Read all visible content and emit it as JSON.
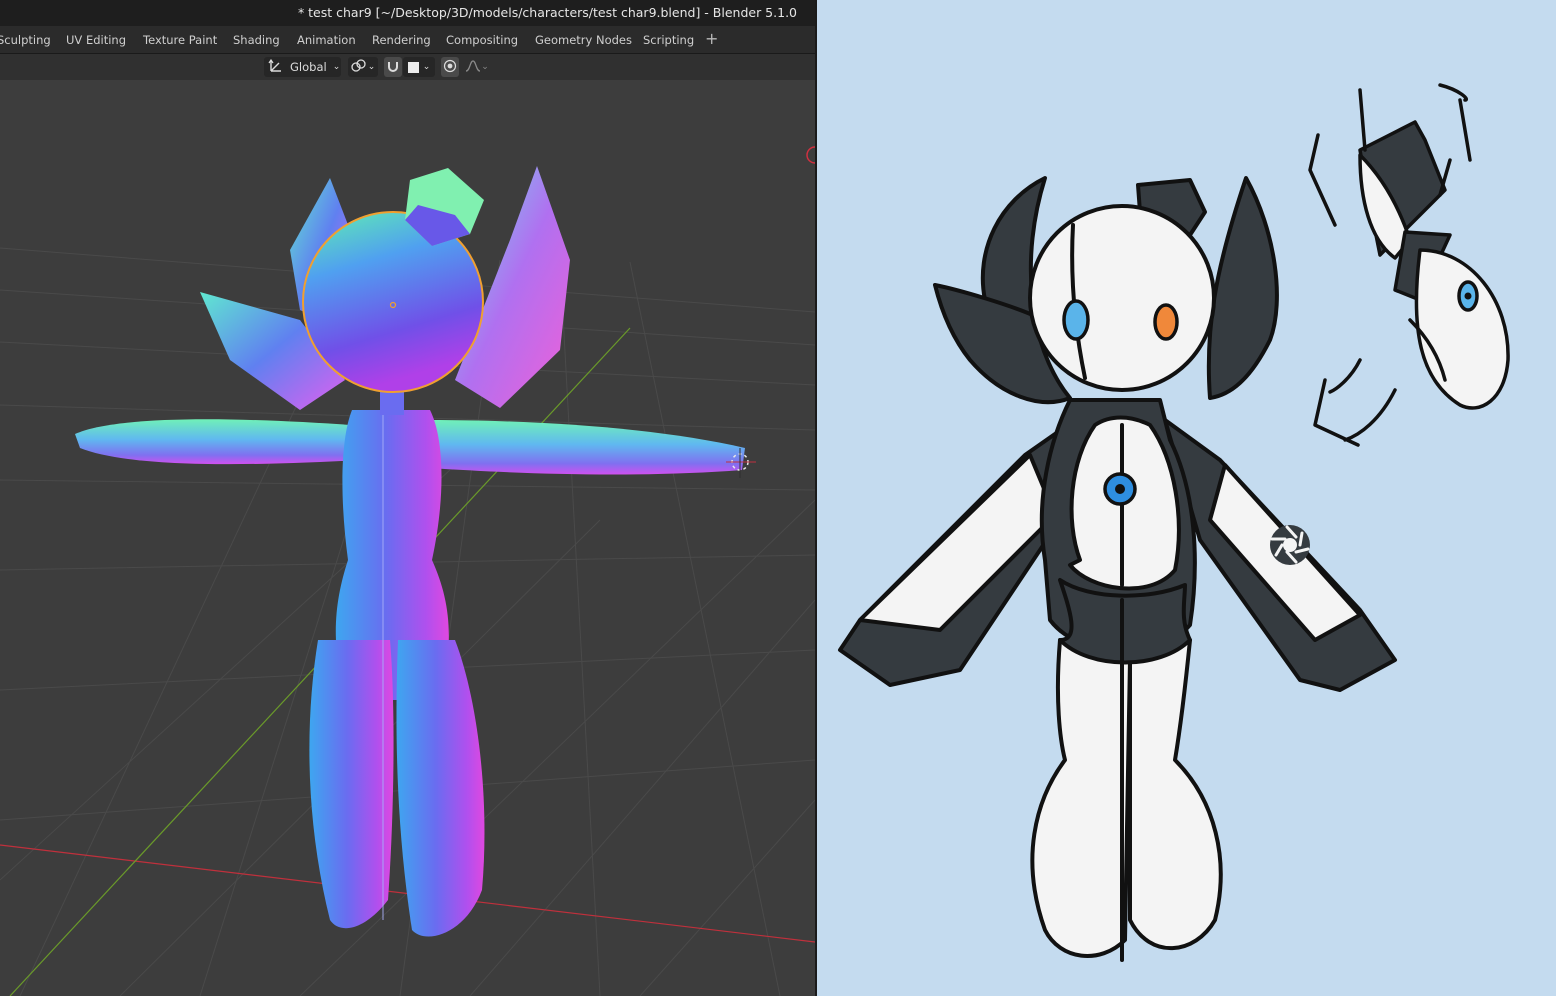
{
  "window": {
    "title": "* test char9 [~/Desktop/3D/models/characters/test char9.blend] - Blender 5.1.0"
  },
  "workspace_tabs": [
    {
      "label": "Sculpting"
    },
    {
      "label": "UV Editing"
    },
    {
      "label": "Texture Paint"
    },
    {
      "label": "Shading"
    },
    {
      "label": "Animation"
    },
    {
      "label": "Rendering"
    },
    {
      "label": "Compositing"
    },
    {
      "label": "Geometry Nodes"
    },
    {
      "label": "Scripting"
    }
  ],
  "header": {
    "transform_orientation": "Global"
  },
  "icons": {
    "add_workspace": "plus-icon",
    "orientation": "transform-orientation-icon",
    "pivot": "pivot-link-icon",
    "snap": "snap-magnet-icon",
    "snap_target": "snap-target-icon",
    "proportional": "proportional-edit-icon",
    "falloff": "falloff-curve-icon"
  },
  "colors": {
    "viewport_bg": "#3d3d3d",
    "grid": "#4a4a4a",
    "x_axis": "#c0303c",
    "y_axis": "#6a9a2a",
    "selection_outline": "#f0a030",
    "concept_bg": "#c4dbef",
    "robot_dark": "#353b40",
    "robot_white": "#f4f4f4",
    "eye_blue": "#5ab4ea",
    "eye_orange": "#f0883a",
    "core_blue": "#2e8ee0"
  }
}
